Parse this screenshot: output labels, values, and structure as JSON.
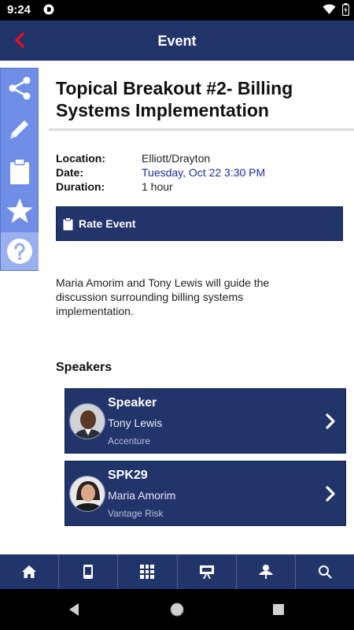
{
  "status_bar": {
    "time": "9:24"
  },
  "app_bar": {
    "title": "Event"
  },
  "side_rail": {
    "items": [
      "share-icon",
      "edit-icon",
      "clipboard-icon",
      "star-icon",
      "help-icon"
    ]
  },
  "event": {
    "title": "Topical Breakout #2- Billing Systems Implementation",
    "location_label": "Location:",
    "location": "Elliott/Drayton",
    "date_label": "Date:",
    "date": "Tuesday, Oct 22 3:30 PM",
    "duration_label": "Duration:",
    "duration": "1 hour",
    "rate_button": "Rate Event",
    "description": "Maria Amorim and Tony Lewis will guide the discussion surrounding billing systems implementation."
  },
  "speakers": {
    "heading": "Speakers",
    "items": [
      {
        "role": "Speaker",
        "name": "Tony Lewis",
        "company": "Accenture"
      },
      {
        "role": "SPK29",
        "name": "Maria Amorim",
        "company": "Vantage Risk"
      }
    ]
  },
  "bottom_nav": {
    "items": [
      "home-icon",
      "device-icon",
      "qr-code-icon",
      "presentation-icon",
      "network-icon",
      "search-icon"
    ]
  },
  "colors": {
    "primary": "#22356b",
    "rail": "#6f8fe6",
    "accent_back": "#e3101c",
    "link": "#1a2a9c"
  }
}
